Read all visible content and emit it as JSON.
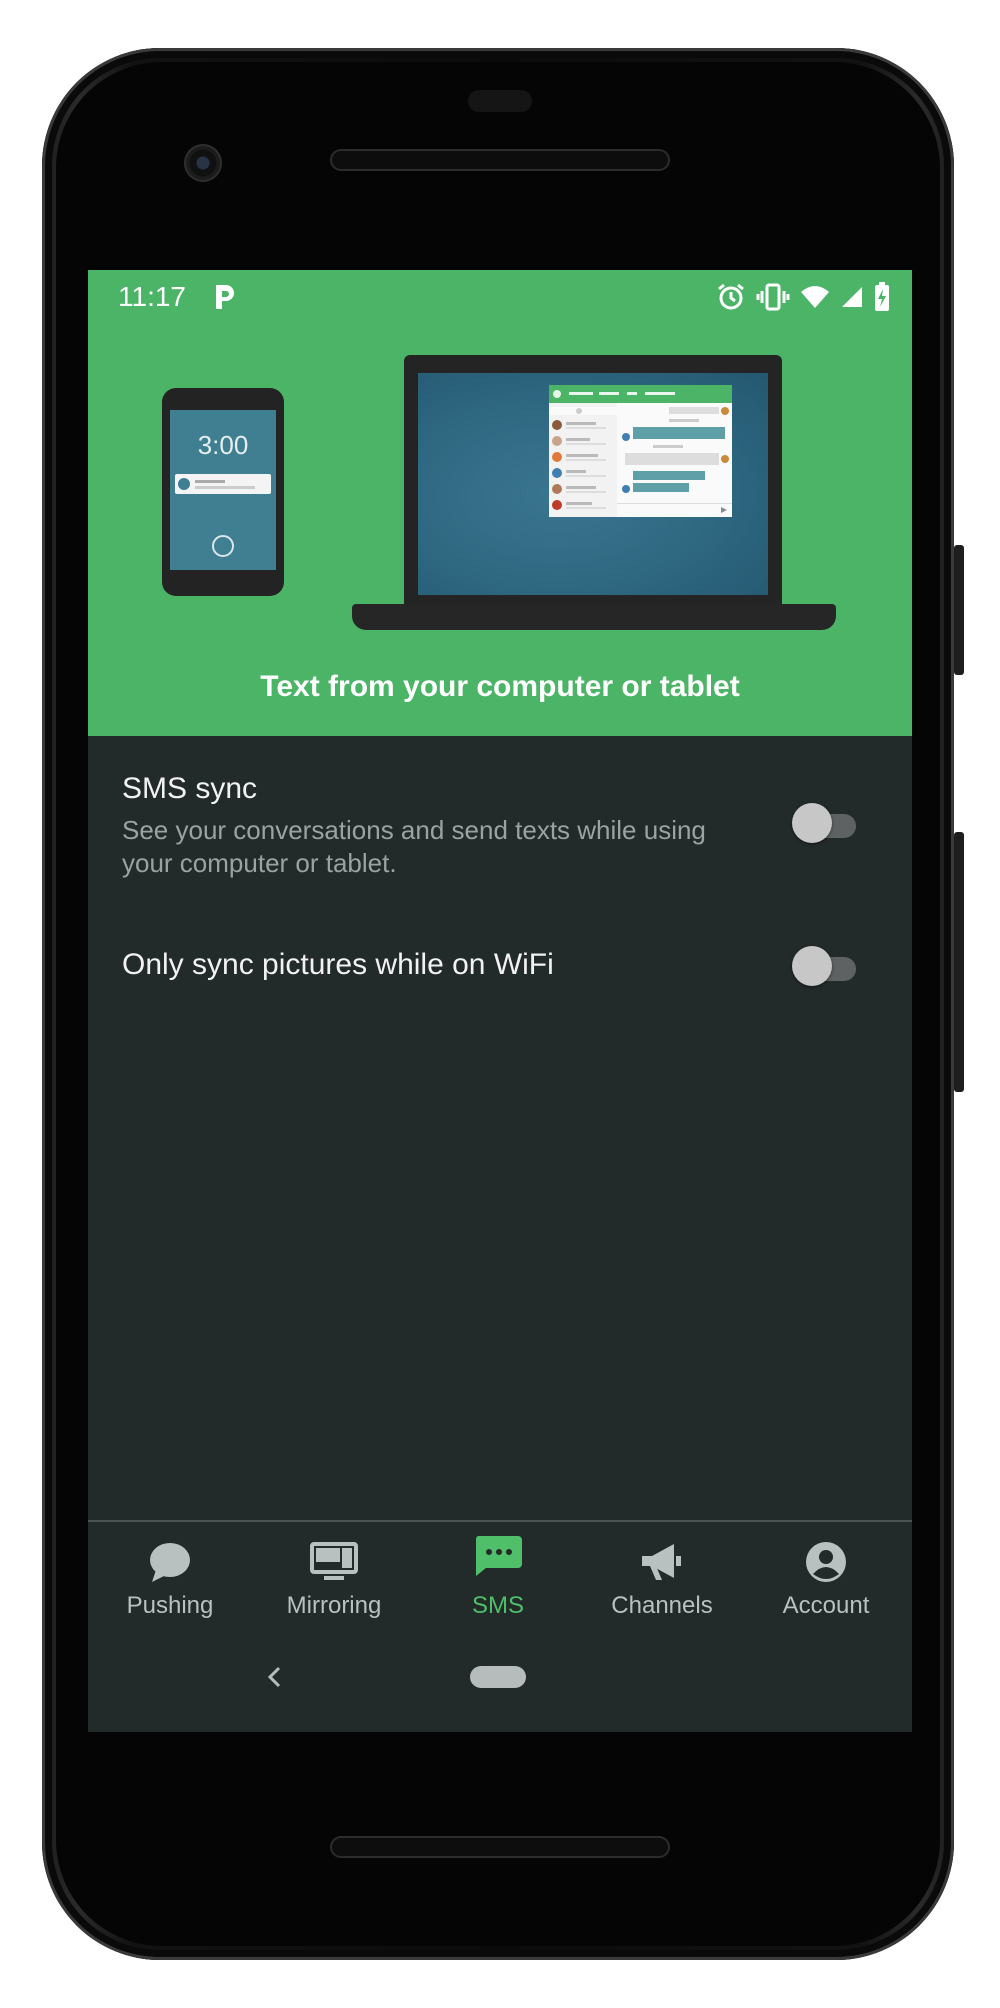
{
  "status_bar": {
    "time": "11:17",
    "icons": [
      "pushbullet-icon",
      "alarm-icon",
      "vibrate-icon",
      "wifi-icon",
      "cell-signal-icon",
      "battery-charging-icon"
    ]
  },
  "hero": {
    "phone_clock": "3:00",
    "caption": "Text from your computer or tablet",
    "background": "#4bb466"
  },
  "settings": [
    {
      "title": "SMS sync",
      "description": "See your conversations and send texts while using your computer or tablet.",
      "enabled": false
    },
    {
      "title": "Only sync pictures while on WiFi",
      "enabled": false
    }
  ],
  "bottom_nav": {
    "items": [
      {
        "label": "Pushing",
        "icon": "chat-bubble-icon",
        "active": false
      },
      {
        "label": "Mirroring",
        "icon": "monitor-icon",
        "active": false
      },
      {
        "label": "SMS",
        "icon": "sms-icon",
        "active": true
      },
      {
        "label": "Channels",
        "icon": "megaphone-icon",
        "active": false
      },
      {
        "label": "Account",
        "icon": "account-circle-icon",
        "active": false
      }
    ],
    "active_color": "#4fbf6a",
    "inactive_color": "#b9c0c0"
  }
}
